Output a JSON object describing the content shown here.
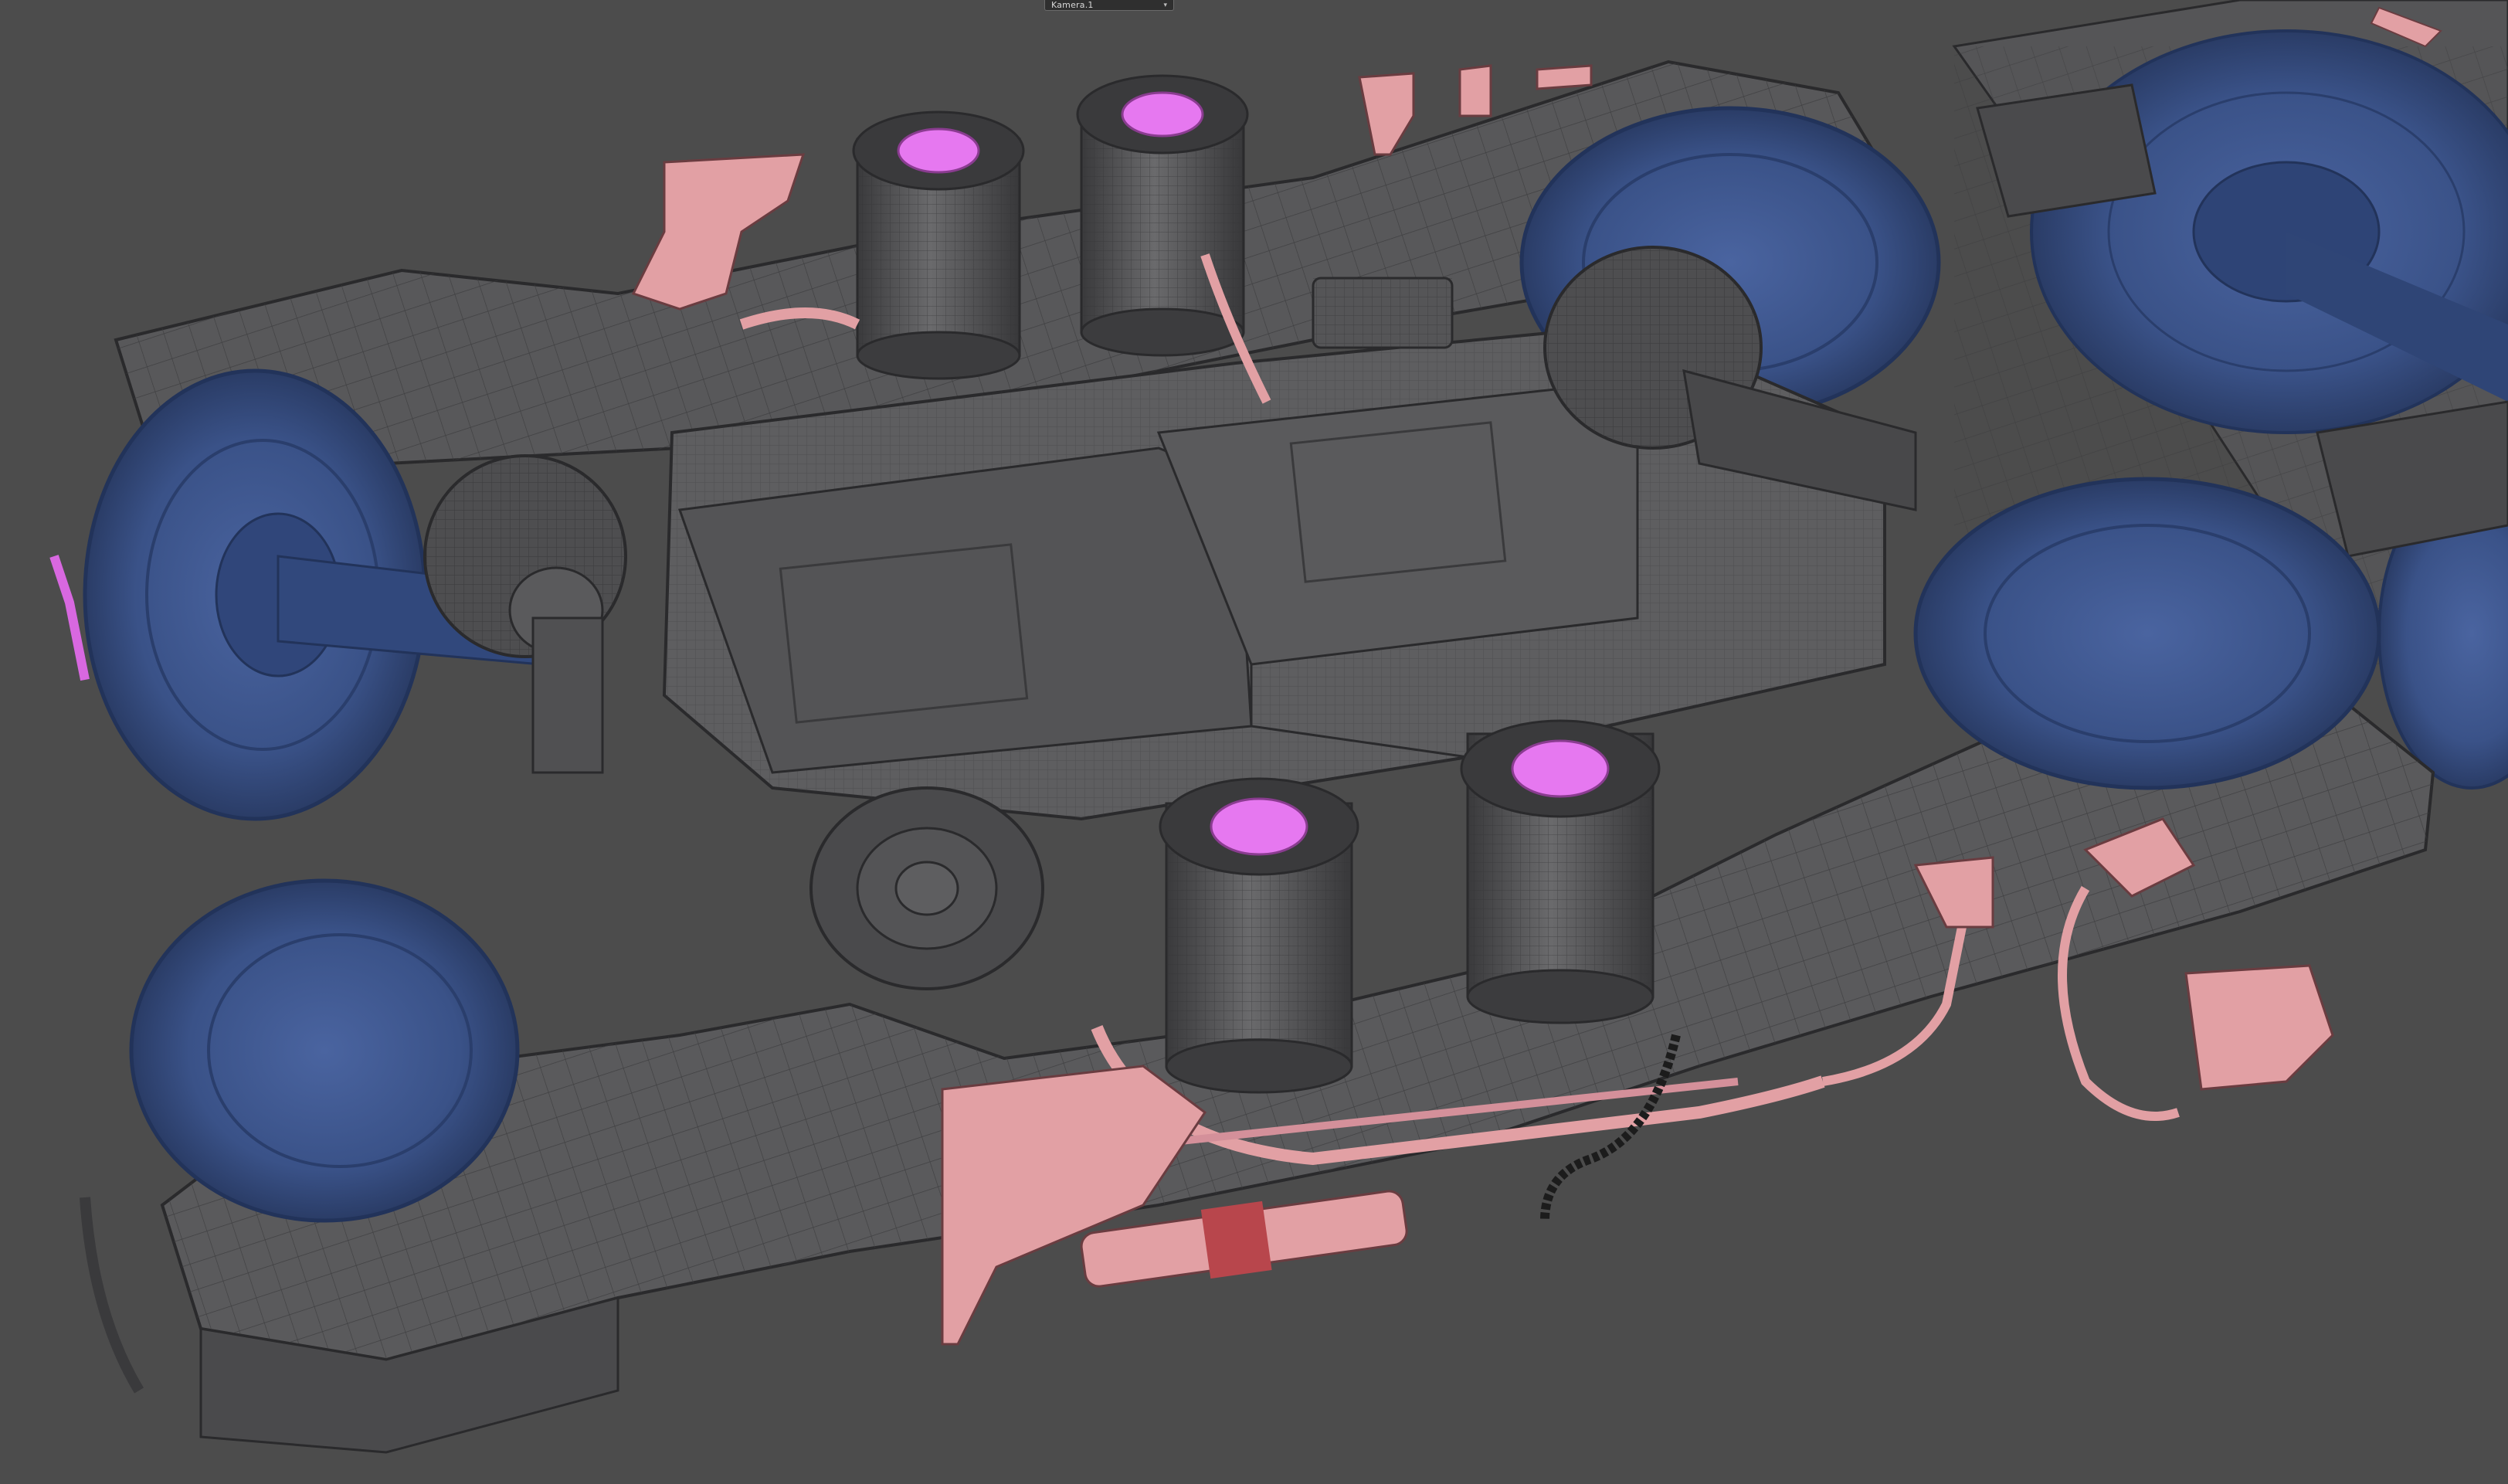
{
  "viewport": {
    "camera_label": "Kamera.1",
    "camera_arrow": "▾"
  },
  "scene": {
    "background": "#4c4c4c",
    "frame_color": "#5a5a5c",
    "frame_edge": "#2a2a2c",
    "wheel_color": "#3a5288",
    "wheel_shade": "#2c3f6c",
    "pipe_color": "#e2a0a4",
    "spring_top_color": "#e678f0",
    "spring_body": "#48484a"
  }
}
